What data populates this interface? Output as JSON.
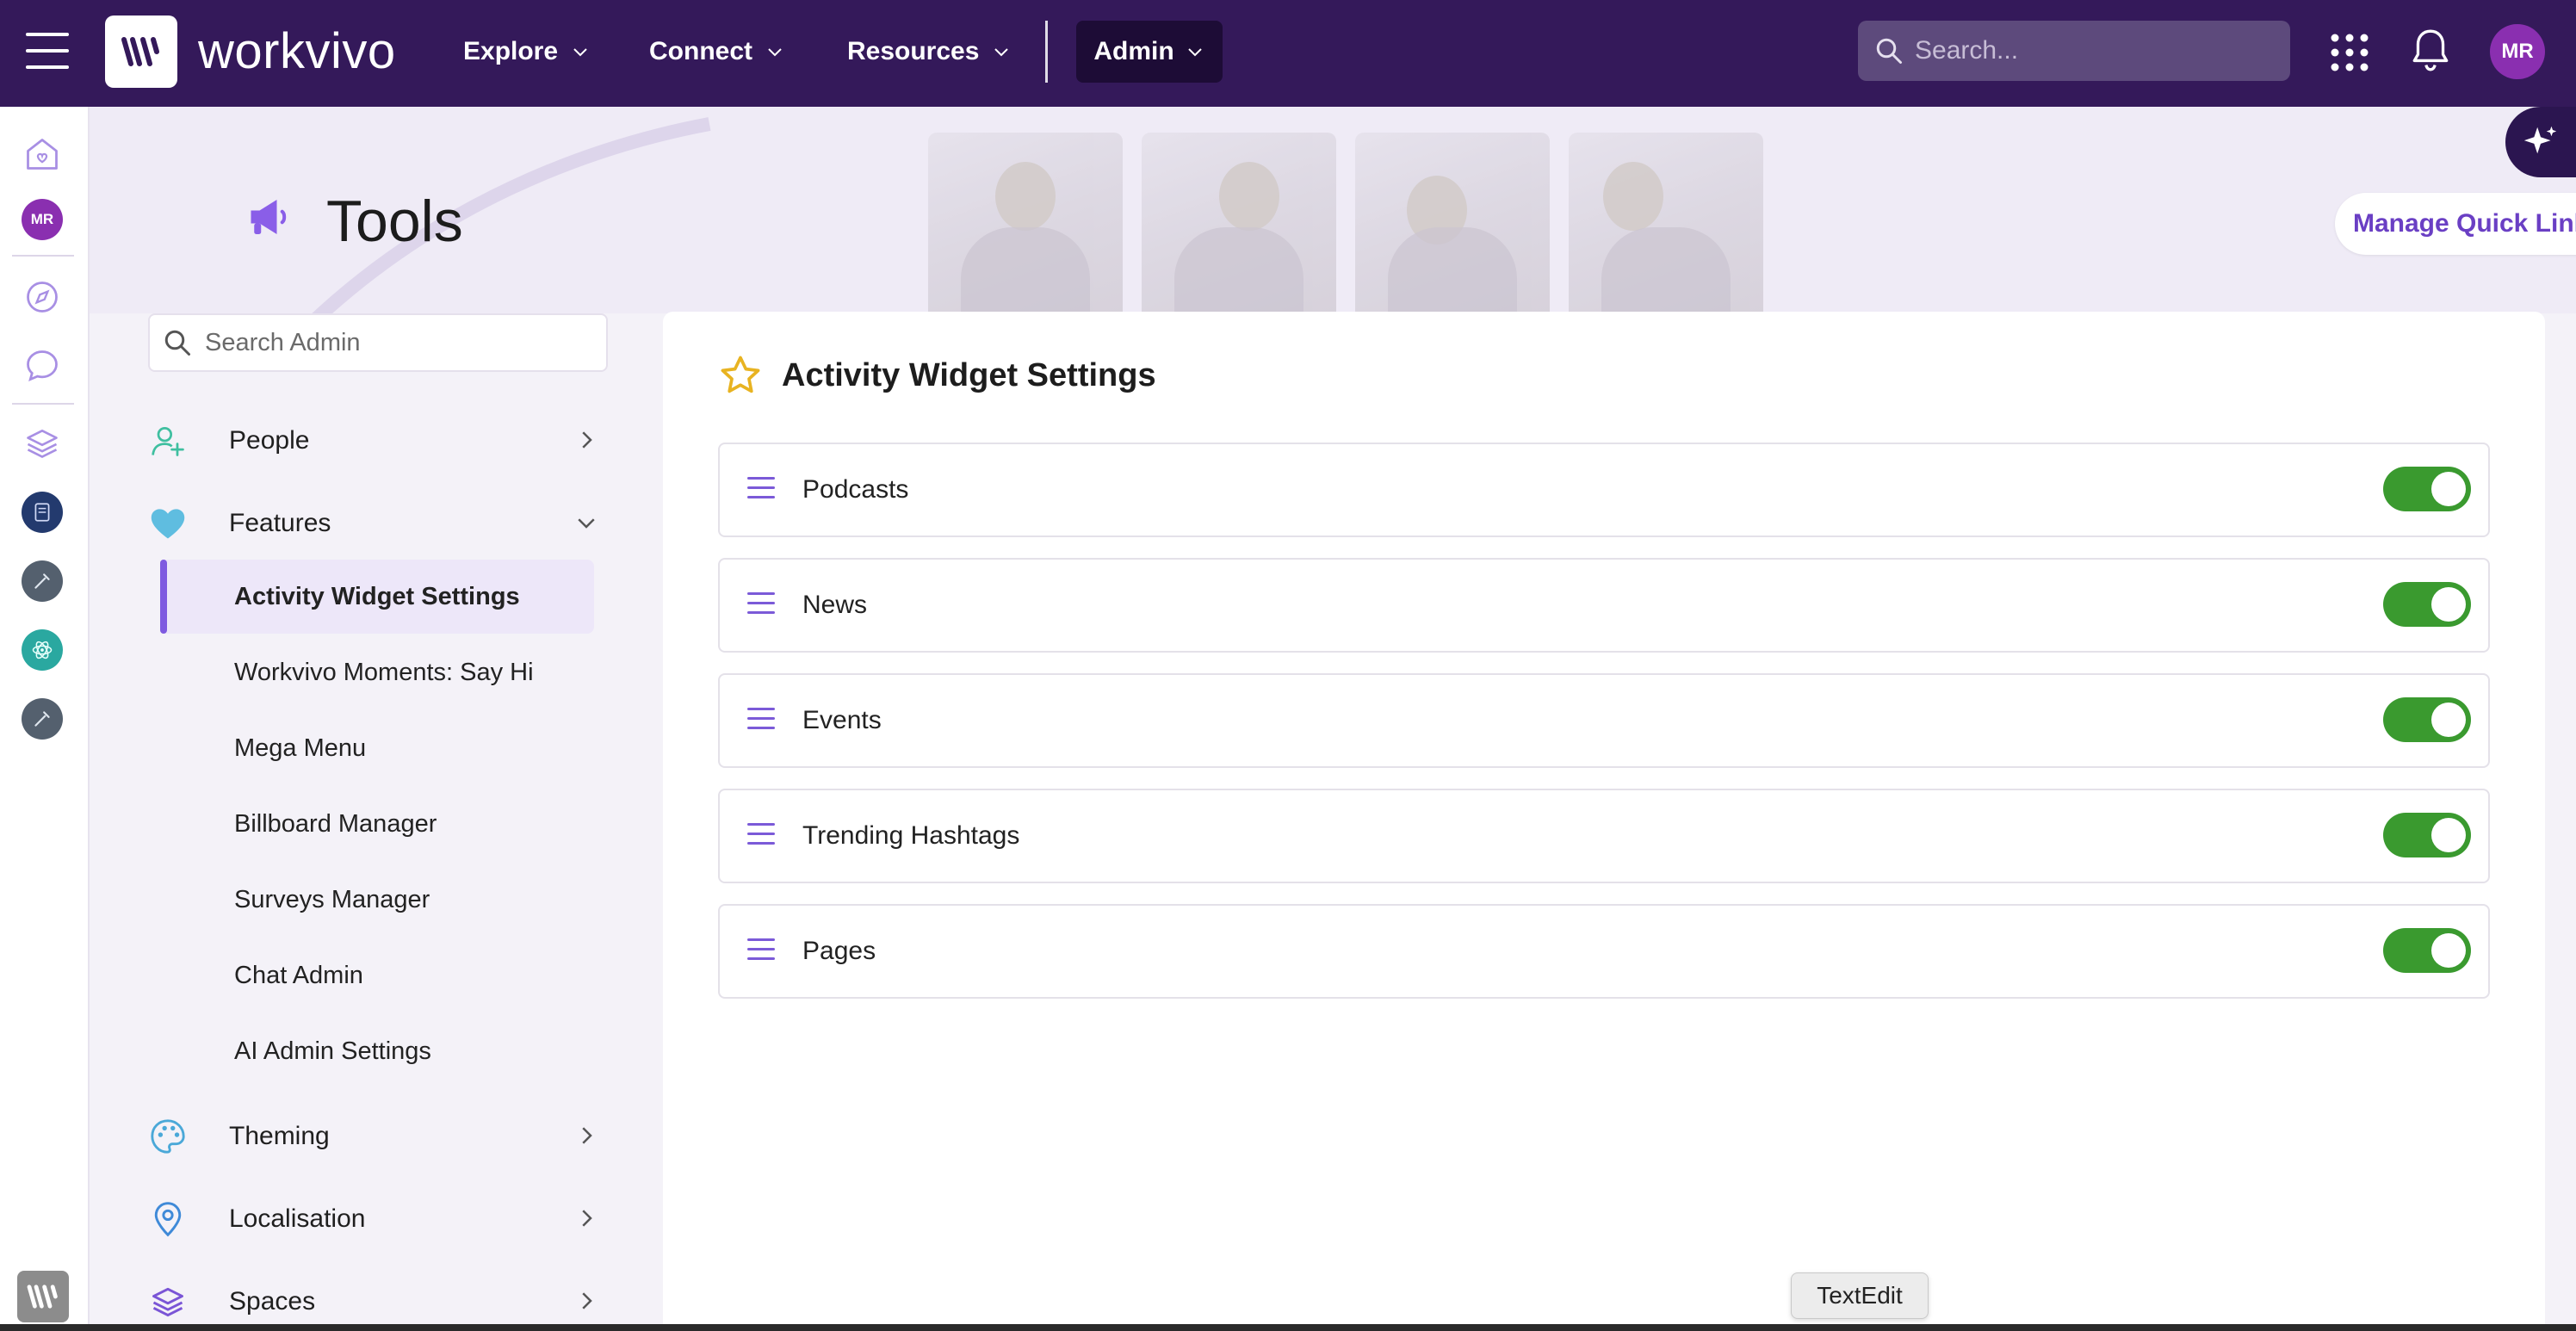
{
  "topbar": {
    "brand": "workvivo",
    "nav": [
      {
        "label": "Explore"
      },
      {
        "label": "Connect"
      },
      {
        "label": "Resources"
      }
    ],
    "admin_label": "Admin",
    "search_placeholder": "Search...",
    "avatar_initials": "MR"
  },
  "rail": {
    "avatar_initials": "MR"
  },
  "header": {
    "title": "Tools",
    "quick_links_label": "Manage Quick Links"
  },
  "sidebar": {
    "search_placeholder": "Search Admin",
    "sections": {
      "people": "People",
      "features": "Features",
      "theming": "Theming",
      "localisation": "Localisation",
      "spaces": "Spaces"
    },
    "feature_items": [
      {
        "label": "Activity Widget Settings",
        "active": true
      },
      {
        "label": "Workvivo Moments: Say Hi"
      },
      {
        "label": "Mega Menu"
      },
      {
        "label": "Billboard Manager"
      },
      {
        "label": "Surveys Manager"
      },
      {
        "label": "Chat Admin"
      },
      {
        "label": "AI Admin Settings"
      }
    ]
  },
  "main": {
    "title": "Activity Widget Settings",
    "settings": [
      {
        "label": "Podcasts",
        "enabled": true
      },
      {
        "label": "News",
        "enabled": true
      },
      {
        "label": "Events",
        "enabled": true
      },
      {
        "label": "Trending Hashtags",
        "enabled": true
      },
      {
        "label": "Pages",
        "enabled": true
      }
    ]
  },
  "tooltip": {
    "text": "TextEdit"
  },
  "colors": {
    "topbar": "#34195a",
    "accent": "#7e5ae0",
    "toggle_on": "#3a9a2f",
    "star": "#e8b321"
  }
}
